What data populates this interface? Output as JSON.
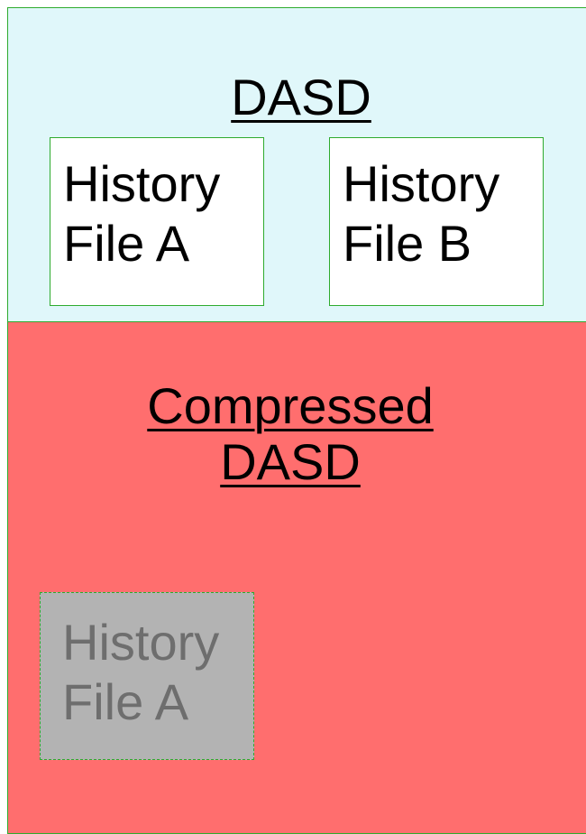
{
  "regions": {
    "dasd": {
      "title": "DASD"
    },
    "compressed": {
      "title_line1": "Compressed",
      "title_line2": "DASD"
    }
  },
  "files": {
    "history_a": {
      "line1": "History",
      "line2": "File A"
    },
    "history_b": {
      "line1": "History",
      "line2": "File B"
    },
    "history_a_compressed": {
      "line1": "History",
      "line2": "File A"
    }
  },
  "colors": {
    "dasd_fill": "#e0f7fa",
    "compressed_fill": "#ff6e6e",
    "border": "#2eab2e",
    "ghost_fill": "#b3b3b3",
    "ghost_text": "#6e6e6e"
  }
}
